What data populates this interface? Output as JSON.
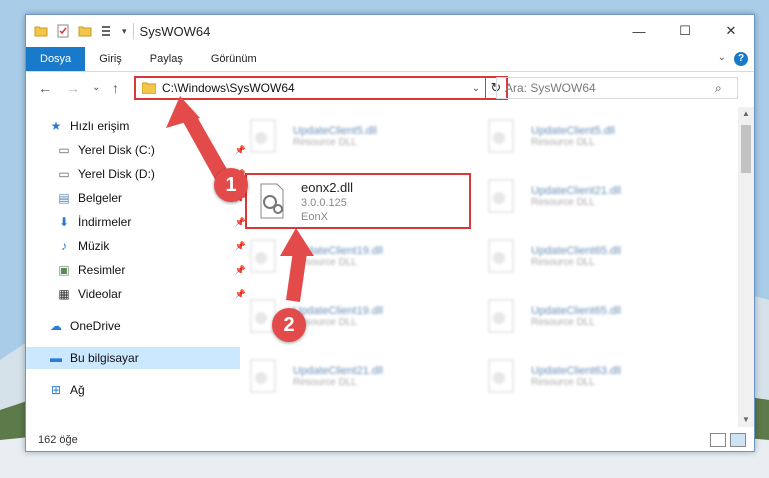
{
  "window": {
    "title": "SysWOW64",
    "minimize": "—",
    "maximize": "☐",
    "close": "✕"
  },
  "ribbon": {
    "tabs": [
      "Dosya",
      "Giriş",
      "Paylaş",
      "Görünüm"
    ],
    "help": "?"
  },
  "nav": {
    "back": "←",
    "forward": "→",
    "recent": "⌄",
    "up": "↑",
    "address": "C:\\Windows\\SysWOW64",
    "refresh": "↻",
    "search_placeholder": "Ara: SysWOW64"
  },
  "sidebar": {
    "items": [
      {
        "label": "Hızlı erişim",
        "icon": "star-icon",
        "pinned": false
      },
      {
        "label": "Yerel Disk (C:)",
        "icon": "drive-icon",
        "pinned": true
      },
      {
        "label": "Yerel Disk (D:)",
        "icon": "drive-icon",
        "pinned": true
      },
      {
        "label": "Belgeler",
        "icon": "documents-icon",
        "pinned": true
      },
      {
        "label": "İndirmeler",
        "icon": "download-icon",
        "pinned": true
      },
      {
        "label": "Müzik",
        "icon": "music-icon",
        "pinned": true
      },
      {
        "label": "Resimler",
        "icon": "pictures-icon",
        "pinned": true
      },
      {
        "label": "Videolar",
        "icon": "videos-icon",
        "pinned": true
      },
      {
        "label": "OneDrive",
        "icon": "cloud-icon",
        "pinned": false
      },
      {
        "label": "Bu bilgisayar",
        "icon": "computer-icon",
        "pinned": false,
        "selected": true
      },
      {
        "label": "Ağ",
        "icon": "network-icon",
        "pinned": false
      }
    ]
  },
  "files": {
    "highlighted": {
      "name": "eonx2.dll",
      "version": "3.0.0.125",
      "company": "EonX"
    },
    "left_column": [
      {
        "name": "UpdateClient5.dll",
        "type": "Resource DLL"
      },
      {
        "name": "UpdateClient19.dll",
        "type": "Resource DLL"
      },
      {
        "name": "UpdateClient19.dll",
        "type": "Resource DLL"
      },
      {
        "name": "UpdateClient21.dll",
        "type": "Resource DLL"
      }
    ],
    "right_column": [
      {
        "name": "UpdateClient5.dll",
        "type": "Resource DLL"
      },
      {
        "name": "UpdateClient21.dll",
        "type": "Resource DLL"
      },
      {
        "name": "UpdateClient65.dll",
        "type": "Resource DLL"
      },
      {
        "name": "UpdateClient65.dll",
        "type": "Resource DLL"
      },
      {
        "name": "UpdateClient63.dll",
        "type": "Resource DLL"
      }
    ]
  },
  "status": {
    "count": "162 öğe"
  },
  "markers": [
    "1",
    "2"
  ],
  "colors": {
    "highlight": "#d9383a",
    "accent": "#1979ca",
    "marker": "#e34b4b"
  }
}
